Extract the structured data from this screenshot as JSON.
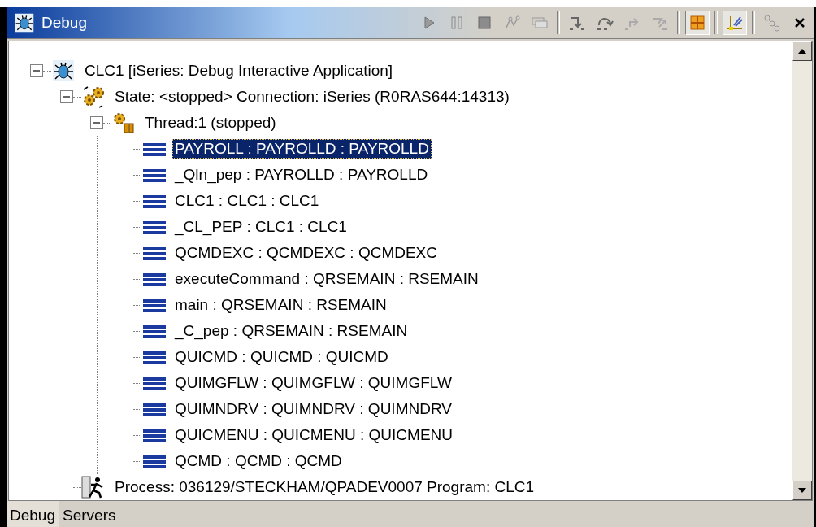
{
  "view": {
    "title": "Debug"
  },
  "toolbar": {
    "groups": [
      [
        {
          "kind": "resume",
          "pressed": false
        },
        {
          "kind": "suspend",
          "pressed": false
        },
        {
          "kind": "terminate",
          "pressed": false
        },
        {
          "kind": "disconnect",
          "pressed": false
        },
        {
          "kind": "remove",
          "pressed": false
        }
      ],
      [
        {
          "kind": "step_into",
          "pressed": false
        },
        {
          "kind": "step_over",
          "pressed": false
        },
        {
          "kind": "step_return",
          "pressed": false
        },
        {
          "kind": "step_filter",
          "pressed": false
        }
      ],
      [
        {
          "kind": "grid",
          "pressed": true
        }
      ],
      [
        {
          "kind": "brush",
          "pressed": true
        }
      ],
      [
        {
          "kind": "links",
          "pressed": false
        },
        {
          "kind": "close",
          "pressed": false
        }
      ]
    ]
  },
  "tree": [
    {
      "kind": "target",
      "label": "CLC1 [iSeries: Debug Interactive Application]",
      "expanded": true,
      "selected": false,
      "children": [
        {
          "kind": "state",
          "label": "State: <stopped> Connection: iSeries (R0RAS644:14313)",
          "expanded": true,
          "selected": false,
          "children": [
            {
              "kind": "thread",
              "label": "Thread:1 (stopped)",
              "expanded": true,
              "selected": false,
              "children": [
                {
                  "kind": "frame",
                  "label": "PAYROLL : PAYROLLD : PAYROLLD",
                  "selected": true
                },
                {
                  "kind": "frame",
                  "label": "_Qln_pep : PAYROLLD : PAYROLLD",
                  "selected": false
                },
                {
                  "kind": "frame",
                  "label": "CLC1 : CLC1 : CLC1",
                  "selected": false
                },
                {
                  "kind": "frame",
                  "label": "_CL_PEP : CLC1 : CLC1",
                  "selected": false
                },
                {
                  "kind": "frame",
                  "label": "QCMDEXC : QCMDEXC : QCMDEXC",
                  "selected": false
                },
                {
                  "kind": "frame",
                  "label": "executeCommand : QRSEMAIN : RSEMAIN",
                  "selected": false
                },
                {
                  "kind": "frame",
                  "label": "main : QRSEMAIN : RSEMAIN",
                  "selected": false
                },
                {
                  "kind": "frame",
                  "label": "_C_pep : QRSEMAIN : RSEMAIN",
                  "selected": false
                },
                {
                  "kind": "frame",
                  "label": "QUICMD : QUICMD : QUICMD",
                  "selected": false
                },
                {
                  "kind": "frame",
                  "label": "QUIMGFLW : QUIMGFLW : QUIMGFLW",
                  "selected": false
                },
                {
                  "kind": "frame",
                  "label": "QUIMNDRV : QUIMNDRV : QUIMNDRV",
                  "selected": false
                },
                {
                  "kind": "frame",
                  "label": "QUICMENU : QUICMENU : QUICMENU",
                  "selected": false
                },
                {
                  "kind": "frame",
                  "label": "QCMD : QCMD : QCMD",
                  "selected": false
                }
              ]
            }
          ]
        },
        {
          "kind": "process",
          "label": "Process: 036129/STECKHAM/QPADEV0007  Program: CLC1",
          "selected": false
        }
      ]
    }
  ],
  "tabs": [
    {
      "label": "Debug",
      "selected": true
    },
    {
      "label": "Servers",
      "selected": false
    }
  ]
}
